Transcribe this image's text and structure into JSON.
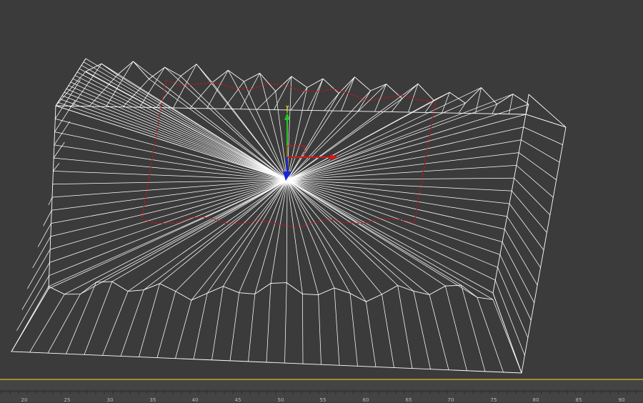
{
  "viewport": {
    "background": "#3b3b3b",
    "wire_color": "#ffffff",
    "selection_color": "#c8141e",
    "gizmo": {
      "axis_y_label": "y",
      "x_color": "#d21919",
      "y_color": "#26c826",
      "z_color": "#1a24d8",
      "pivot_color": "#e6e61e"
    }
  },
  "timeline": {
    "accent_color": "#a38a2a",
    "ticks": [
      "20",
      "25",
      "30",
      "35",
      "40",
      "45",
      "50",
      "55",
      "60",
      "65",
      "70",
      "75",
      "80",
      "85",
      "90"
    ]
  }
}
